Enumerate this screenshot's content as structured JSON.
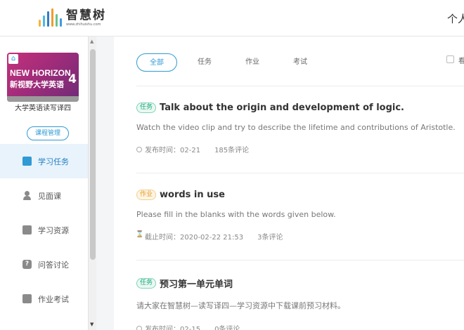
{
  "header": {
    "logo_text": "智慧树",
    "logo_url": "www.zhihuishu.com",
    "right_text": "个人"
  },
  "course": {
    "cover_brand": "NEW HORIZON",
    "cover_title": "新视野大学英语",
    "cover_number": "4",
    "name": "大学英语读写译四",
    "manage_label": "课程管理"
  },
  "menu": {
    "items": [
      {
        "label": "学习任务",
        "icon": "task-list-icon",
        "active": true
      },
      {
        "label": "见面课",
        "icon": "person-icon",
        "active": false
      },
      {
        "label": "学习资源",
        "icon": "book-icon",
        "active": false
      },
      {
        "label": "问答讨论",
        "icon": "question-icon",
        "active": false
      },
      {
        "label": "作业考试",
        "icon": "exam-icon",
        "active": false
      }
    ]
  },
  "tabs": [
    {
      "label": "全部",
      "active": true
    },
    {
      "label": "任务",
      "active": false
    },
    {
      "label": "作业",
      "active": false
    },
    {
      "label": "考试",
      "active": false
    }
  ],
  "filter_label": "看",
  "cards": [
    {
      "badge": "任务",
      "badge_type": "task",
      "title": "Talk about the origin and development of logic.",
      "desc": "Watch the video clip and try to describe the lifetime and contributions of Aristotle.",
      "time": "发布时间：02-21",
      "comments": "185条评论"
    },
    {
      "badge": "作业",
      "badge_type": "homework",
      "title": "words in use",
      "desc": "Please fill in the blanks with the words given below.",
      "time": "截止时间：2020-02-22 21:53",
      "comments": "3条评论"
    },
    {
      "badge": "任务",
      "badge_type": "task",
      "title": "预习第一单元单词",
      "desc": "请大家在智慧树—读写译四—学习资源中下载课前预习材料。",
      "time": "发布时间：02-15",
      "comments": "0条评论"
    }
  ],
  "colors": {
    "accent": "#2f9ad4",
    "task_badge": "#1aa87a",
    "homework_badge": "#e69a1e"
  }
}
